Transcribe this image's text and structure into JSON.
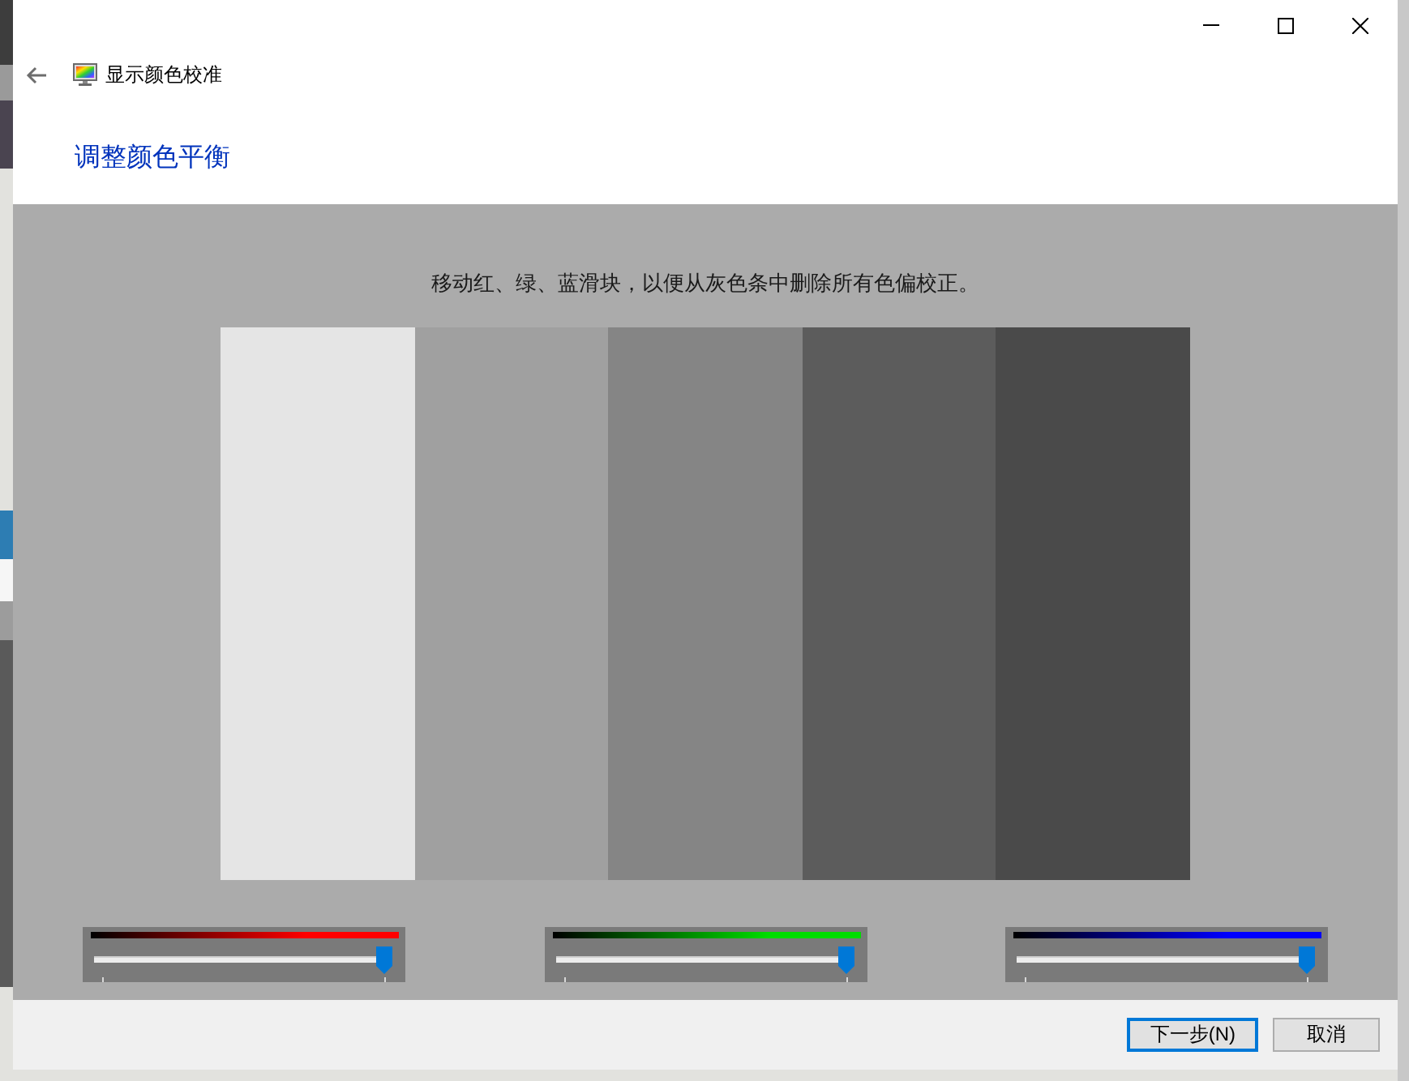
{
  "window": {
    "title": "显示颜色校准"
  },
  "heading": "调整颜色平衡",
  "instruction": "移动红、绿、蓝滑块，以便从灰色条中删除所有色偏校正。",
  "gray_bars": [
    {
      "color": "#e5e5e5"
    },
    {
      "color": "#a0a0a0"
    },
    {
      "color": "#858585"
    },
    {
      "color": "#5c5c5c"
    },
    {
      "color": "#4a4a4a"
    }
  ],
  "sliders": [
    {
      "color": "#ff0000",
      "level": 1
    },
    {
      "color": "#00dd00",
      "level": 1
    },
    {
      "color": "#0000ff",
      "level": 1
    }
  ],
  "buttons": [
    {
      "label": "下一步(N)",
      "default": true
    },
    {
      "label": "取消",
      "default": false
    }
  ]
}
